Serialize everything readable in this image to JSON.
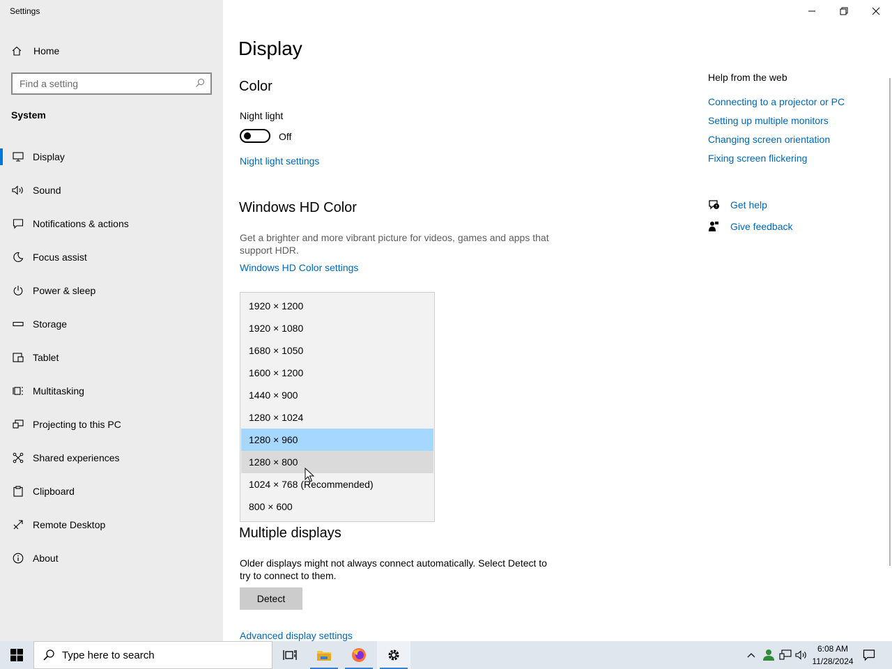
{
  "window": {
    "title": "Settings",
    "buttons": {
      "minimize": "minimize-icon",
      "restore": "restore-icon",
      "close": "close-icon"
    }
  },
  "sidebar": {
    "home_label": "Home",
    "search_placeholder": "Find a setting",
    "section": "System",
    "items": [
      {
        "label": "Display",
        "icon": "display-icon",
        "active": true
      },
      {
        "label": "Sound",
        "icon": "speaker-icon"
      },
      {
        "label": "Notifications & actions",
        "icon": "notification-icon"
      },
      {
        "label": "Focus assist",
        "icon": "moon-icon"
      },
      {
        "label": "Power & sleep",
        "icon": "power-icon"
      },
      {
        "label": "Storage",
        "icon": "storage-icon"
      },
      {
        "label": "Tablet",
        "icon": "tablet-icon"
      },
      {
        "label": "Multitasking",
        "icon": "multitasking-icon"
      },
      {
        "label": "Projecting to this PC",
        "icon": "projecting-icon"
      },
      {
        "label": "Shared experiences",
        "icon": "shared-icon"
      },
      {
        "label": "Clipboard",
        "icon": "clipboard-icon"
      },
      {
        "label": "Remote Desktop",
        "icon": "remote-desktop-icon"
      },
      {
        "label": "About",
        "icon": "info-icon"
      }
    ]
  },
  "main": {
    "page_title": "Display",
    "color": {
      "heading": "Color",
      "night_light_label": "Night light",
      "night_light_state": "Off",
      "night_light_settings_link": "Night light settings"
    },
    "hd_color": {
      "heading": "Windows HD Color",
      "description": "Get a brighter and more vibrant picture for videos, games and apps that support HDR.",
      "settings_link": "Windows HD Color settings"
    },
    "resolution_dropdown": {
      "options": [
        "1920 × 1200",
        "1920 × 1080",
        "1680 × 1050",
        "1600 × 1200",
        "1440 × 900",
        "1280 × 1024",
        "1280 × 960",
        "1280 × 800",
        "1024 × 768 (Recommended)",
        "800 × 600"
      ],
      "selected_index": 6,
      "hover_index": 7
    },
    "multiple_displays": {
      "heading": "Multiple displays",
      "description": "Older displays might not always connect automatically. Select Detect to try to connect to them.",
      "detect_button": "Detect",
      "advanced_link": "Advanced display settings"
    }
  },
  "help": {
    "title": "Help from the web",
    "links": [
      "Connecting to a projector or PC",
      "Setting up multiple monitors",
      "Changing screen orientation",
      "Fixing screen flickering"
    ],
    "get_help": "Get help",
    "give_feedback": "Give feedback"
  },
  "taskbar": {
    "search_placeholder": "Type here to search",
    "apps": [
      "task-view-icon",
      "file-explorer-icon",
      "firefox-icon",
      "settings-icon"
    ],
    "time": "6:08 AM",
    "date": "11/28/2024",
    "colors": {
      "accent": "#0078d7",
      "link": "#0067b8",
      "selected": "#a6d8ff"
    }
  }
}
